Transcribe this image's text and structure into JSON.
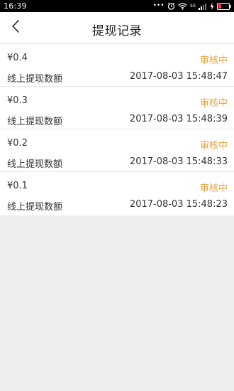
{
  "status_bar": {
    "time": "16:39",
    "network": "3G",
    "dots": "•••"
  },
  "header": {
    "title": "提现记录",
    "back_icon": "chevron-left-icon"
  },
  "records": [
    {
      "amount": "¥0.4",
      "status": "审核中",
      "type": "线上提现数额",
      "datetime": "2017-08-03 15:48:47"
    },
    {
      "amount": "¥0.3",
      "status": "审核中",
      "type": "线上提现数额",
      "datetime": "2017-08-03 15:48:39"
    },
    {
      "amount": "¥0.2",
      "status": "审核中",
      "type": "线上提现数额",
      "datetime": "2017-08-03 15:48:33"
    },
    {
      "amount": "¥0.1",
      "status": "审核中",
      "type": "线上提现数额",
      "datetime": "2017-08-03 15:48:23"
    }
  ],
  "colors": {
    "status_pending": "#e8a13a",
    "background": "#eeeeee",
    "status_bar": "#000000"
  }
}
